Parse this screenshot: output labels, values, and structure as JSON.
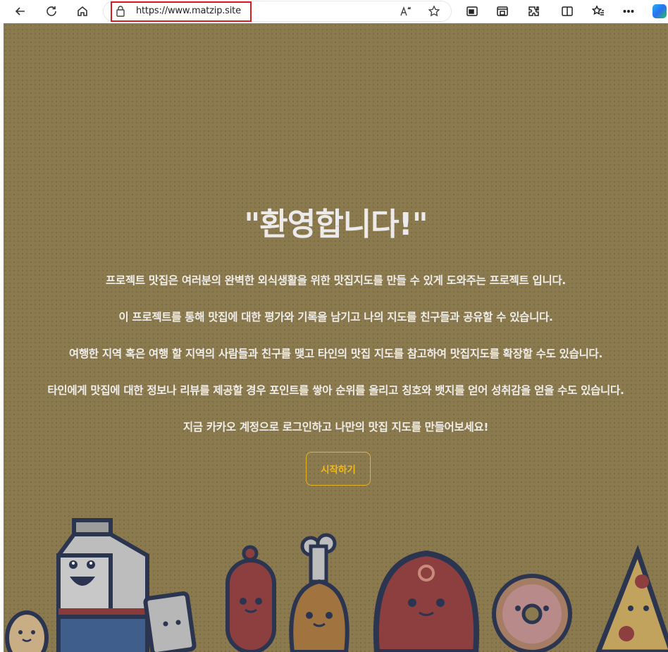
{
  "browser": {
    "url": "https://www.matzip.site",
    "icons": [
      "back-icon",
      "refresh-icon",
      "home-icon",
      "lock-icon",
      "read-aloud-icon",
      "favorite-star-icon",
      "picture-in-picture-icon",
      "screencast-icon",
      "extensions-icon",
      "split-screen-icon",
      "favorites-icon",
      "more-icon",
      "copilot-icon"
    ]
  },
  "hero": {
    "title": "\"환영합니다!\"",
    "lines": [
      "프로젝트 맛집은 여러분의 완벽한 외식생활을 위한 맛집지도를 만들 수 있게 도와주는 프로젝트 입니다.",
      "이 프로젝트를 통해 맛집에 대한 평가와 기록을 남기고 나의 지도를 친구들과 공유할 수 있습니다.",
      "여행한 지역 혹은 여행 할 지역의 사람들과 친구를 맺고 타인의 맛집 지도를 참고하여 맛집지도를 확장할 수도 있습니다.",
      "타인에게 맛집에 대한 정보나 리뷰를 제공할 경우 포인트를 쌓아 순위를 올리고 칭호와 뱃지를 얻어 성취감을 얻을 수도 있습니다.",
      "지금 카카오 계정으로 로그인하고 나만의 맛집 지도를 만들어보세요!"
    ],
    "start_button": "시작하기"
  },
  "colors": {
    "background": "#8c7a4f",
    "accent": "#f0b91c",
    "highlight_box": "#d81b25"
  }
}
